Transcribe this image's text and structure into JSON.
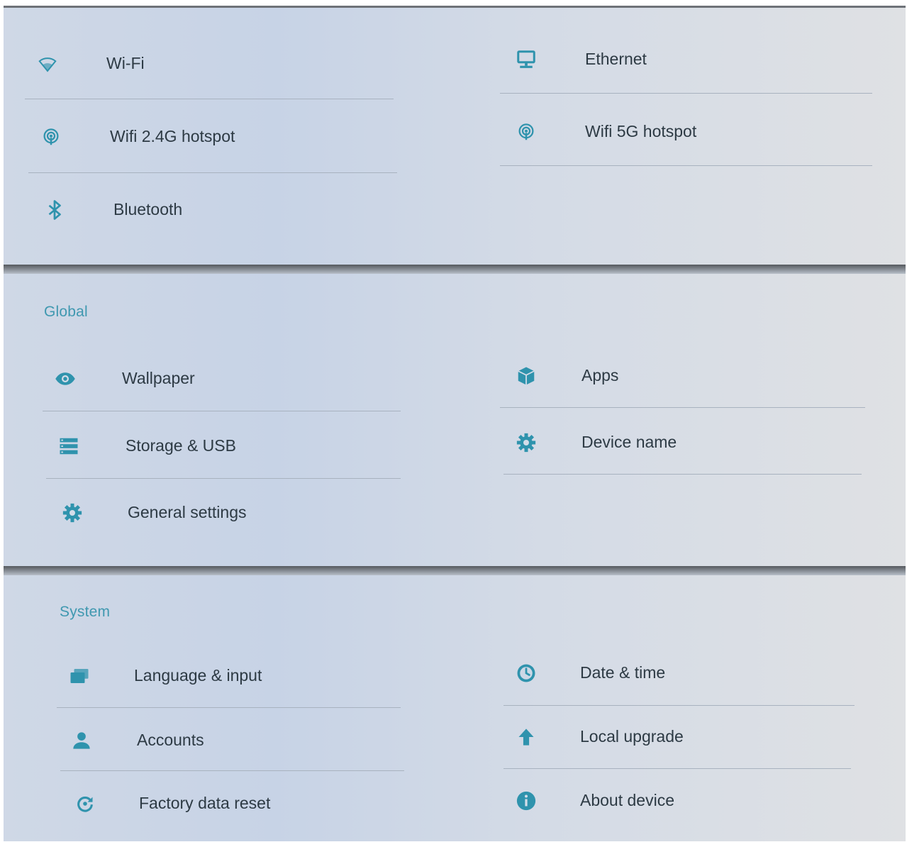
{
  "network": {
    "items": [
      {
        "label": "Wi-Fi",
        "icon": "wifi-icon"
      },
      {
        "label": "Ethernet",
        "icon": "ethernet-icon"
      },
      {
        "label": "Wifi 2.4G hotspot",
        "icon": "hotspot-icon"
      },
      {
        "label": "Wifi 5G hotspot",
        "icon": "hotspot-icon"
      },
      {
        "label": "Bluetooth",
        "icon": "bluetooth-icon"
      }
    ]
  },
  "global": {
    "title": "Global",
    "items": [
      {
        "label": "Wallpaper",
        "icon": "eye-icon"
      },
      {
        "label": "Apps",
        "icon": "apps-cube-icon"
      },
      {
        "label": "Storage & USB",
        "icon": "storage-icon"
      },
      {
        "label": "Device name",
        "icon": "gear-icon"
      },
      {
        "label": "General settings",
        "icon": "gear-icon"
      }
    ]
  },
  "system": {
    "title": "System",
    "items": [
      {
        "label": "Language & input",
        "icon": "keyboard-icon"
      },
      {
        "label": "Date & time",
        "icon": "clock-icon"
      },
      {
        "label": "Accounts",
        "icon": "person-icon"
      },
      {
        "label": "Local upgrade",
        "icon": "upload-arrow-icon"
      },
      {
        "label": "Factory data reset",
        "icon": "reset-icon"
      },
      {
        "label": "About device",
        "icon": "info-icon"
      }
    ]
  },
  "colors": {
    "accent": "#3f98b0",
    "icon": "#2f93ad",
    "text": "#2d3a44"
  }
}
